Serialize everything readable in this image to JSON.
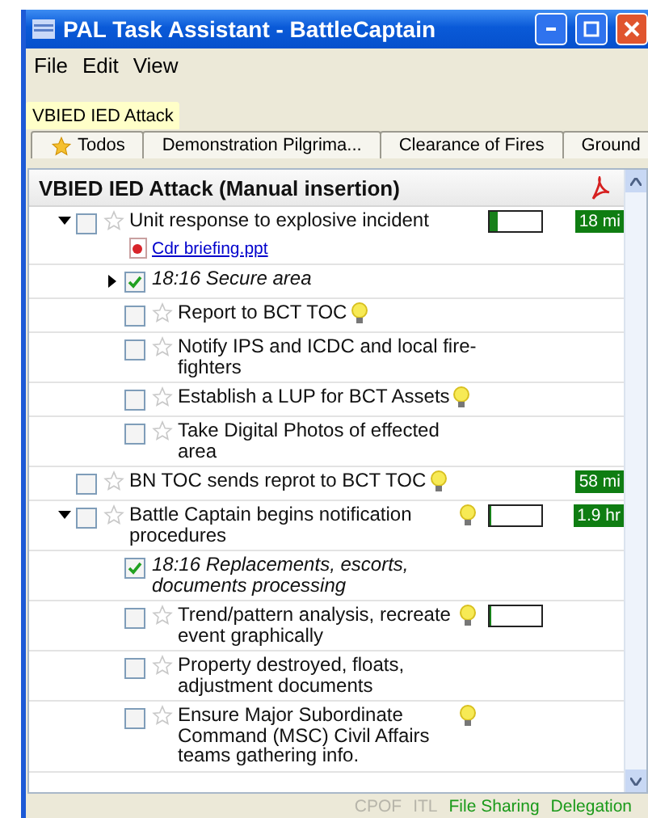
{
  "window": {
    "title": "PAL Task Assistant - BattleCaptain"
  },
  "menu": [
    "File",
    "Edit",
    "View"
  ],
  "tab_rows": [
    [
      {
        "label": "VBIED  IED Attack",
        "selected": true,
        "kind": "plain"
      }
    ],
    [
      {
        "label": "Todos",
        "selected": false,
        "kind": "starred"
      },
      {
        "label": "Demonstration Pilgrima...",
        "selected": false,
        "kind": "plain"
      },
      {
        "label": "Clearance of Fires",
        "selected": false,
        "kind": "plain"
      },
      {
        "label": "Ground",
        "selected": false,
        "kind": "plain"
      }
    ]
  ],
  "panel": {
    "title": "VBIED  IED Attack (Manual insertion)",
    "tasks": [
      {
        "text": "Unit response to explosive incident",
        "checked": false,
        "starred": false,
        "hint": false,
        "expanded": true,
        "level": 0.15,
        "time": "18 mi",
        "attachments": [
          "Cdr briefing.ppt"
        ],
        "children": [
          {
            "text": "18:16 Secure area",
            "checked": true,
            "hint": false,
            "expanded": false
          },
          {
            "text": "Report to BCT TOC",
            "checked": false,
            "starred": false,
            "hint": true
          },
          {
            "text": "Notify IPS and ICDC and local fire-fighters",
            "checked": false,
            "starred": false,
            "hint": false
          },
          {
            "text": "Establish a LUP for BCT Assets",
            "checked": false,
            "starred": false,
            "hint": true
          },
          {
            "text": "Take Digital Photos of effected area",
            "checked": false,
            "starred": false,
            "hint": false
          }
        ]
      },
      {
        "text": "BN TOC sends reprot to BCT TOC",
        "checked": false,
        "starred": false,
        "hint": true,
        "time": "58 mi"
      },
      {
        "text": "Battle Captain begins notification procedures",
        "checked": false,
        "starred": false,
        "hint": true,
        "expanded": true,
        "level": 0.03,
        "time": "1.9 hr",
        "children": [
          {
            "text": "18:16 Replacements, escorts, documents processing",
            "checked": true,
            "hint": false
          },
          {
            "text": "Trend/pattern analysis, recreate event graphically",
            "checked": false,
            "starred": false,
            "hint": true,
            "level": 0
          },
          {
            "text": "Property destroyed, floats, adjustment documents",
            "checked": false,
            "starred": false,
            "hint": false
          },
          {
            "text": "Ensure Major Subordinate Command (MSC) Civil Affairs teams gathering info.",
            "checked": false,
            "starred": false,
            "hint": true
          }
        ]
      }
    ]
  },
  "status_bar": [
    {
      "label": "CPOF",
      "enabled": false
    },
    {
      "label": "ITL",
      "enabled": false
    },
    {
      "label": "File Sharing",
      "enabled": true
    },
    {
      "label": "Delegation",
      "enabled": true
    }
  ]
}
